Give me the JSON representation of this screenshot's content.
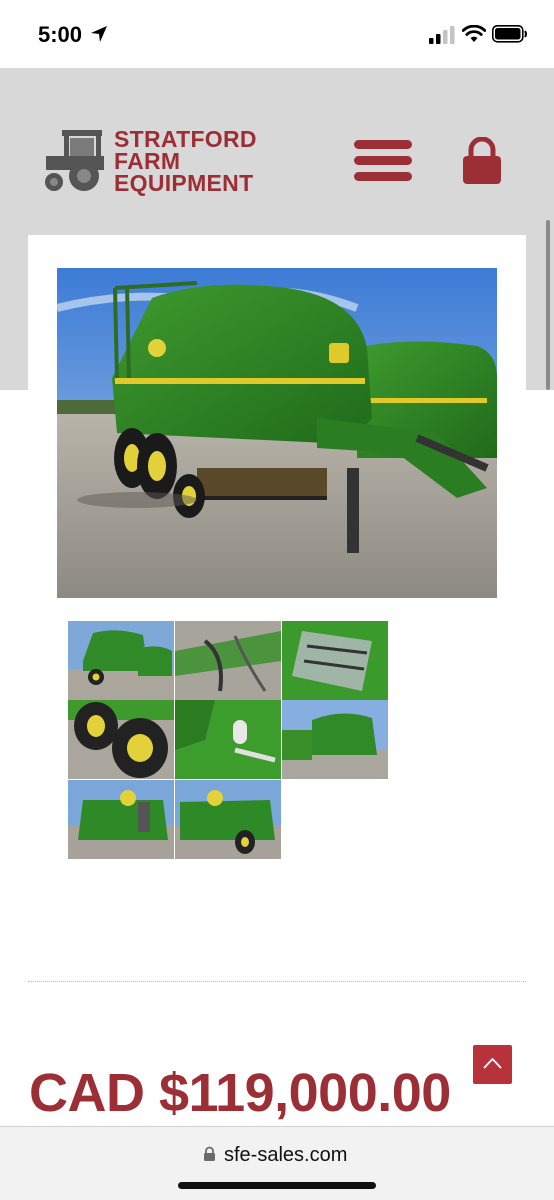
{
  "status_bar": {
    "time": "5:00"
  },
  "header": {
    "logo_lines": [
      "STRATFORD",
      "FARM",
      "EQUIPMENT"
    ],
    "brand_color": "#9c2f36",
    "menu_icon": "hamburger-icon",
    "lock_icon": "lock-icon"
  },
  "gallery": {
    "main_image_alt": "main-product-photo",
    "thumbnail_count": 8
  },
  "listing": {
    "price": "CAD $119,000.00"
  },
  "browser": {
    "url": "sfe-sales.com"
  }
}
